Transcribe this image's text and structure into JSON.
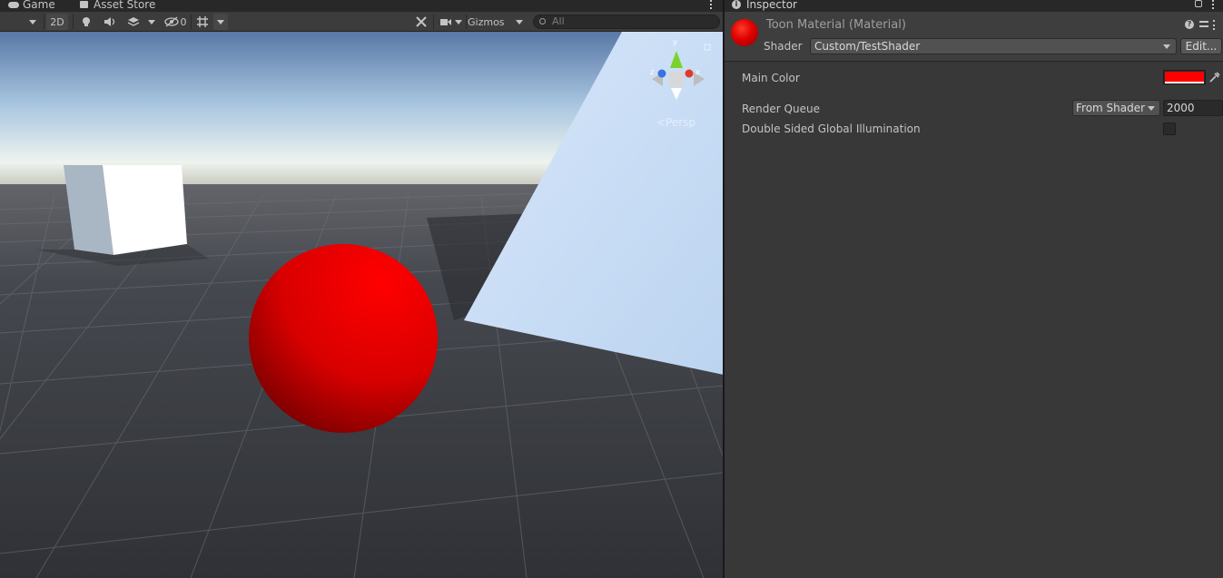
{
  "tabs": {
    "game": "Game",
    "asset_store": "Asset Store",
    "inspector": "Inspector"
  },
  "scene_toolbar": {
    "mode_2d": "2D",
    "hidden_count": "0",
    "gizmos": "Gizmos",
    "search_placeholder": "All"
  },
  "viewport": {
    "projection_label": "<Persp",
    "axis_y": "y",
    "axis_x": "x",
    "axis_z": "z"
  },
  "inspector": {
    "title": "Toon Material (Material)",
    "shader_label": "Shader",
    "shader_value": "Custom/TestShader",
    "edit_button": "Edit...",
    "properties": {
      "main_color_label": "Main Color",
      "main_color_value": "#ff0000",
      "render_queue_label": "Render Queue",
      "render_queue_mode": "From Shader",
      "render_queue_value": "2000",
      "double_sided_gi_label": "Double Sided Global Illumination",
      "double_sided_gi_checked": false
    }
  },
  "colors": {
    "editor_bg": "#383838",
    "toolbar_bg": "#3c3c3c",
    "sphere": "#e00000",
    "grid_floor": "#393b3f",
    "sky_top": "#5a7aa8",
    "plane": "#c7dbf5"
  }
}
